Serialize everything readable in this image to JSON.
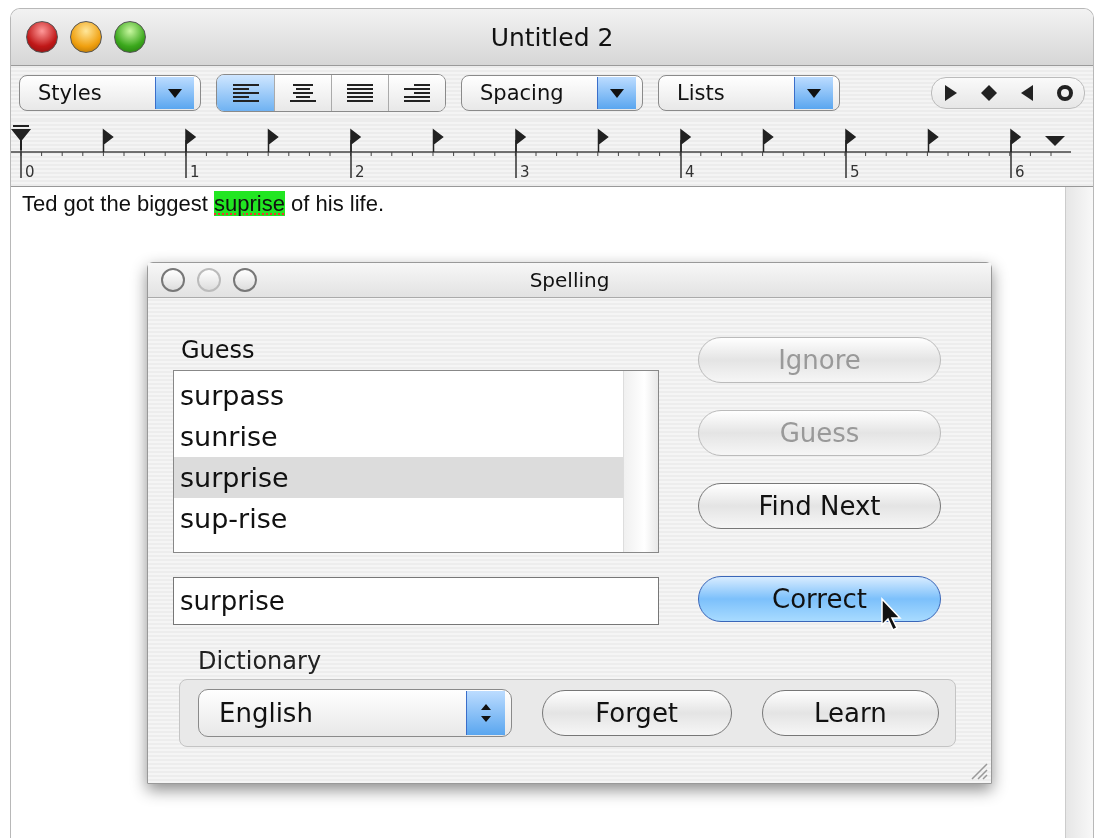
{
  "window": {
    "title": "Untitled 2"
  },
  "toolbar": {
    "styles": "Styles",
    "alignment": [
      {
        "kind": "left",
        "selected": true
      },
      {
        "kind": "center",
        "selected": false
      },
      {
        "kind": "justify",
        "selected": false
      },
      {
        "kind": "right",
        "selected": false
      }
    ],
    "spacing": "Spacing",
    "lists": "Lists"
  },
  "ruler": {
    "labels": [
      "0",
      "1",
      "2",
      "3",
      "4",
      "5",
      "6"
    ]
  },
  "document": {
    "before": "Ted got the biggest ",
    "misspelled": "suprise",
    "after": " of his life."
  },
  "spelling": {
    "title": "Spelling",
    "guess_label": "Guess",
    "guesses": [
      {
        "text": "surpass",
        "selected": false
      },
      {
        "text": "sunrise",
        "selected": false
      },
      {
        "text": "surprise",
        "selected": true
      },
      {
        "text": "sup-rise",
        "selected": false
      }
    ],
    "word": "surprise",
    "buttons": [
      {
        "label": "Ignore",
        "disabled": true,
        "default": false
      },
      {
        "label": "Guess",
        "disabled": true,
        "default": false
      },
      {
        "label": "Find Next",
        "disabled": false,
        "default": false
      },
      {
        "label": "Correct",
        "disabled": false,
        "default": true
      }
    ],
    "dictionary_label": "Dictionary",
    "language": "English",
    "dictionary_buttons": [
      "Forget",
      "Learn"
    ]
  }
}
